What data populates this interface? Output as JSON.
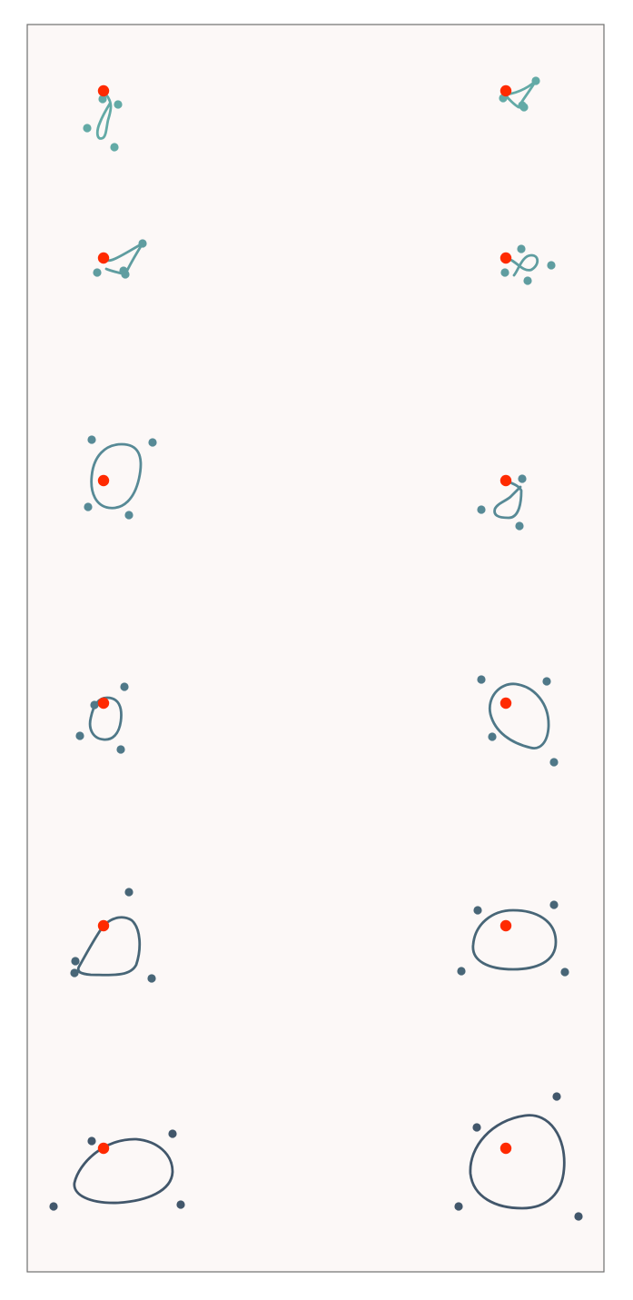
{
  "colors": {
    "background": "#fcf8f7",
    "frame": "#6f6f6f",
    "anchor_point": "#ff2a00",
    "gradient": [
      "#63aaa6",
      "#5f9da0",
      "#578a96",
      "#4f7888",
      "#486677",
      "#42576b"
    ]
  },
  "figures": [
    {
      "id": "fig-1",
      "row": 0,
      "col": 0,
      "shape": "loop"
    },
    {
      "id": "fig-2",
      "row": 0,
      "col": 1,
      "shape": "swoosh"
    },
    {
      "id": "fig-3",
      "row": 1,
      "col": 0,
      "shape": "swoosh"
    },
    {
      "id": "fig-4",
      "row": 1,
      "col": 1,
      "shape": "figure-eight"
    },
    {
      "id": "fig-5",
      "row": 2,
      "col": 0,
      "shape": "closed-loop"
    },
    {
      "id": "fig-6",
      "row": 2,
      "col": 1,
      "shape": "teardrop"
    },
    {
      "id": "fig-7",
      "row": 3,
      "col": 0,
      "shape": "closed-loop"
    },
    {
      "id": "fig-8",
      "row": 3,
      "col": 1,
      "shape": "closed-loop"
    },
    {
      "id": "fig-9",
      "row": 4,
      "col": 0,
      "shape": "teardrop"
    },
    {
      "id": "fig-10",
      "row": 4,
      "col": 1,
      "shape": "closed-loop"
    },
    {
      "id": "fig-11",
      "row": 5,
      "col": 0,
      "shape": "closed-loop"
    },
    {
      "id": "fig-12",
      "row": 5,
      "col": 1,
      "shape": "closed-loop"
    }
  ]
}
